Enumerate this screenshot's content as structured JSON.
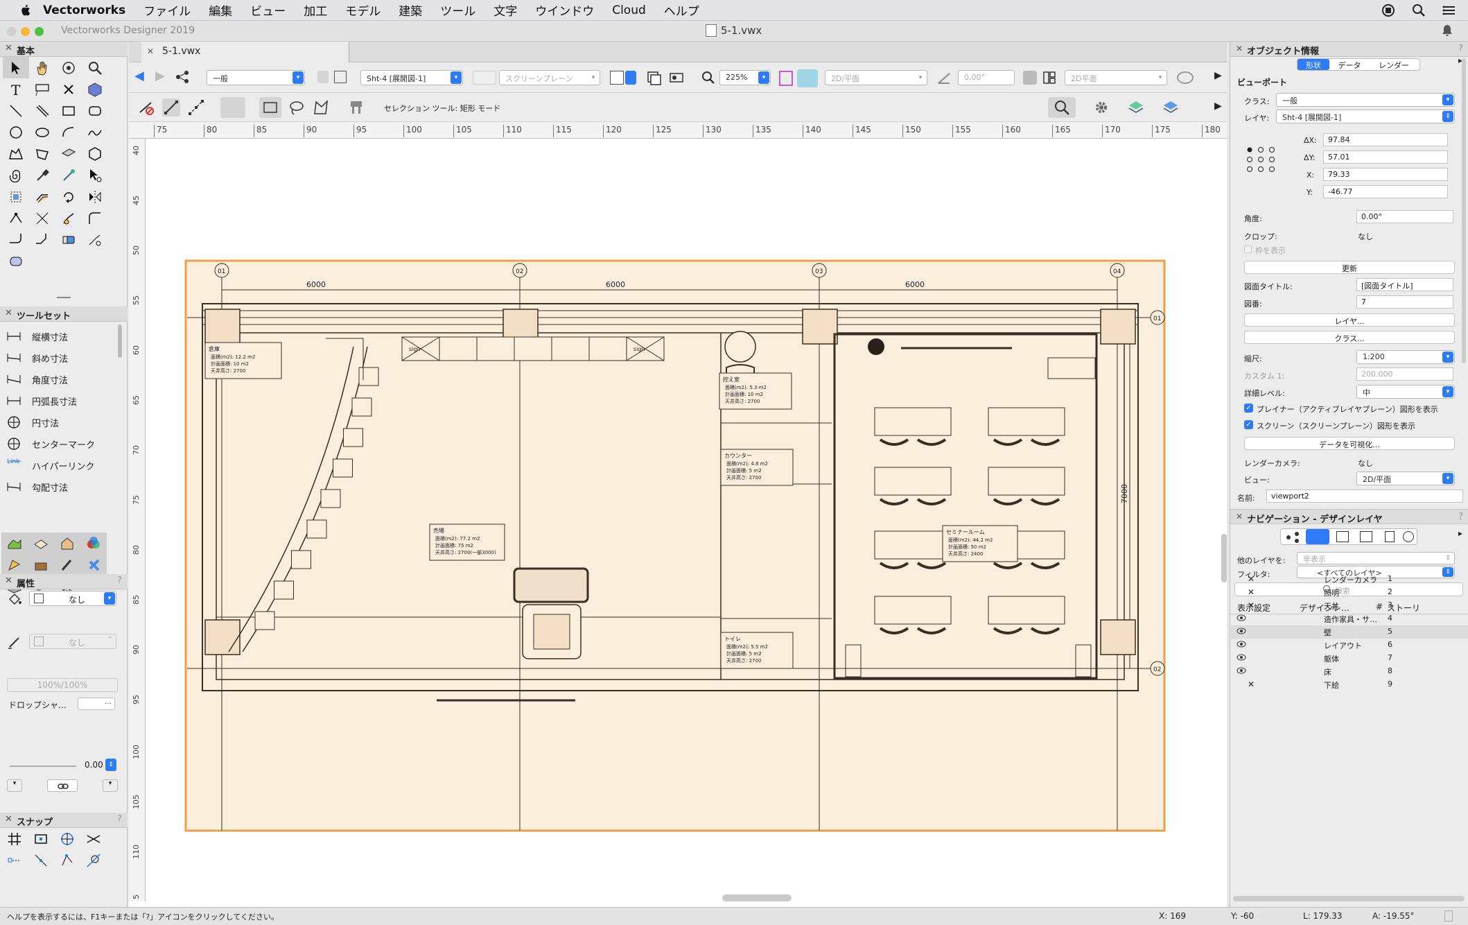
{
  "menubar": {
    "app_name": "Vectorworks",
    "items": [
      "ファイル",
      "編集",
      "ビュー",
      "加工",
      "モデル",
      "建築",
      "ツール",
      "文字",
      "ウインドウ",
      "Cloud",
      "ヘルプ"
    ]
  },
  "window": {
    "app_title": "Vectorworks Designer 2019",
    "doc_title": "5-1.vwx",
    "tab_label": "5-1.vwx"
  },
  "left_panel": {
    "basic_title": "基本",
    "toolsets_title": "ツールセット",
    "toolsets": [
      "縦横寸法",
      "斜め寸法",
      "角度寸法",
      "円弧長寸法",
      "円寸法",
      "センターマーク",
      "ハイパーリンク",
      "勾配寸法"
    ],
    "hyperlink_badge": "Link",
    "attributes_title": "属性",
    "fill_value": "なし",
    "pen_value": "なし",
    "opacity": "100%/100%",
    "drop_shadow_label": "ドロップシャ…",
    "line_weight": "0.00",
    "snap_title": "スナップ"
  },
  "toolbar": {
    "class": "一般",
    "layer": "Sht-4 [展開図-1]",
    "plane": "スクリーンプレーン",
    "zoom": "225%",
    "view": "2D/平面",
    "angle": "0.00°",
    "render": "2D平面",
    "mode_text": "セレクション ツール: 矩形 モード"
  },
  "rulers": {
    "h_ticks": [
      "75",
      "80",
      "85",
      "90",
      "95",
      "100",
      "105",
      "110",
      "115",
      "120",
      "125",
      "130",
      "135",
      "140",
      "145",
      "150",
      "155",
      "160",
      "165",
      "170",
      "175",
      "180"
    ],
    "v_ticks": [
      "40",
      "45",
      "50",
      "55",
      "60",
      "65",
      "70",
      "75",
      "80",
      "85",
      "90",
      "95",
      "100",
      "105",
      "110",
      "5"
    ]
  },
  "drawing": {
    "grid_labels": [
      "01",
      "02",
      "03",
      "04"
    ],
    "row_grid_labels": [
      "01",
      "02"
    ],
    "dim_spans": [
      "6000",
      "6000",
      "6000"
    ],
    "dim_vertical": "7000",
    "signs": [
      "sign",
      "sign"
    ],
    "rooms": [
      {
        "name": "倉庫",
        "l1": "面積(m2): 12.2 m2",
        "l2": "計画面積: 10 m2",
        "l3": "天井高さ: 2700"
      },
      {
        "name": "控え室",
        "l1": "面積(m2): 5.3 m2",
        "l2": "計画面積: 10 m2",
        "l3": "天井高さ: 2700"
      },
      {
        "name": "カウンター",
        "l1": "面積(m2): 4.8 m2",
        "l2": "計画面積: 5 m2",
        "l3": "天井高さ: 2700"
      },
      {
        "name": "売場",
        "l1": "面積(m2): 77.2 m2",
        "l2": "計画面積: 75 m2",
        "l3": "天井高さ: 2700(一部3000)"
      },
      {
        "name": "セミナールーム",
        "l1": "面積(m2): 44.2 m2",
        "l2": "計画面積: 50 m2",
        "l3": "天井高さ: 2400"
      },
      {
        "name": "トイレ",
        "l1": "面積(m2): 5.5 m2",
        "l2": "計画面積: 5 m2",
        "l3": "天井高さ: 2700"
      }
    ]
  },
  "obj_info": {
    "title": "オブジェクト情報",
    "tabs": [
      "形状",
      "データ",
      "レンダー"
    ],
    "object_type": "ビューポート",
    "class_label": "クラス:",
    "class_value": "一般",
    "layer_label": "レイヤ:",
    "layer_value": "Sht-4 [展開図-1]",
    "dx_label": "ΔX:",
    "dx": "97.84",
    "dy_label": "ΔY:",
    "dy": "57.01",
    "x_label": "X:",
    "x": "79.33",
    "y_label": "Y:",
    "y": "-46.77",
    "angle_label": "角度:",
    "angle": "0.00°",
    "crop_label": "クロップ:",
    "crop": "なし",
    "show_frame": "枠を表示",
    "update_btn": "更新",
    "drawing_title_label": "図面タイトル:",
    "drawing_title": "[図面タイトル]",
    "drawing_no_label": "図番:",
    "drawing_no": "7",
    "layers_btn": "レイヤ...",
    "classes_btn": "クラス...",
    "scale_label": "縮尺:",
    "scale": "1:200",
    "custom_label": "カスタム 1:",
    "custom": "200.000",
    "detail_label": "詳細レベル:",
    "detail": "中",
    "planar_chk": "プレイナー（アクティブレイヤプレーン）図形を表示",
    "screen_chk": "スクリーン（スクリーンプレーン）図形を表示",
    "viz_btn": "データを可視化...",
    "camera_label": "レンダーカメラ:",
    "camera": "なし",
    "view_label": "ビュー:",
    "view": "2D/平面",
    "name_label": "名前:",
    "name": "viewport2"
  },
  "nav": {
    "title": "ナビゲーション - デザインレイヤ",
    "other_label": "他のレイヤを:",
    "other_value": "非表示",
    "filter_label": "フィルタ:",
    "filter_value": "<すべてのレイヤ>",
    "search_placeholder": "検索",
    "col_vis": "表示設定",
    "col_name": "デザインレ…",
    "col_num": "#",
    "col_story": "ストーリ",
    "layers": [
      {
        "vis": "x",
        "name": "レンダーカメラ",
        "num": "1"
      },
      {
        "vis": "x",
        "name": "照明",
        "num": "2"
      },
      {
        "vis": "x",
        "name": "天井",
        "num": "3"
      },
      {
        "vis": "eye",
        "name": "造作家具・サ…",
        "num": "4"
      },
      {
        "vis": "eye",
        "name": "壁",
        "num": "5"
      },
      {
        "vis": "eye",
        "name": "レイアウト",
        "num": "6"
      },
      {
        "vis": "eye",
        "name": "躯体",
        "num": "7"
      },
      {
        "vis": "eye",
        "name": "床",
        "num": "8"
      },
      {
        "vis": "x",
        "name": "下絵",
        "num": "9"
      }
    ]
  },
  "status": {
    "help": "ヘルプを表示するには、F1キーまたは「?」アイコンをクリックしてください。",
    "x": "X: 169",
    "y": "Y: -60",
    "l": "L: 179.33",
    "a": "A: -19.55°"
  }
}
